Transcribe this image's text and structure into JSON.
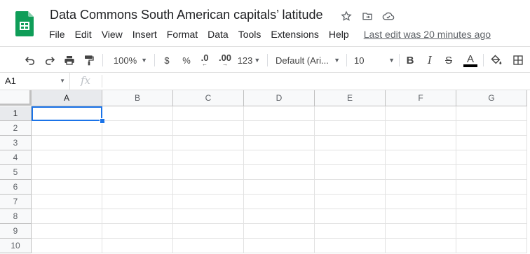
{
  "doc": {
    "title": "Data Commons South American capitals’ latitude",
    "brand_color": "#0f9d58"
  },
  "menu": [
    "File",
    "Edit",
    "View",
    "Insert",
    "Format",
    "Data",
    "Tools",
    "Extensions",
    "Help"
  ],
  "last_edit": "Last edit was 20 minutes ago",
  "toolbar": {
    "zoom": "100%",
    "currency": "$",
    "percent": "%",
    "decimal_decrease": ".0",
    "decimal_increase": ".00",
    "number_format": "123",
    "font": "Default (Ari...",
    "font_size": "10",
    "bold": "B",
    "italic": "I",
    "strikethrough": "S",
    "text_color_letter": "A"
  },
  "formula_bar": {
    "cell_ref": "A1",
    "fx_label": "fx",
    "value": ""
  },
  "grid": {
    "columns": [
      "A",
      "B",
      "C",
      "D",
      "E",
      "F",
      "G"
    ],
    "rows": [
      "1",
      "2",
      "3",
      "4",
      "5",
      "6",
      "7",
      "8",
      "9",
      "10"
    ],
    "selected_cell": "A1",
    "selection_color": "#1a73e8"
  }
}
